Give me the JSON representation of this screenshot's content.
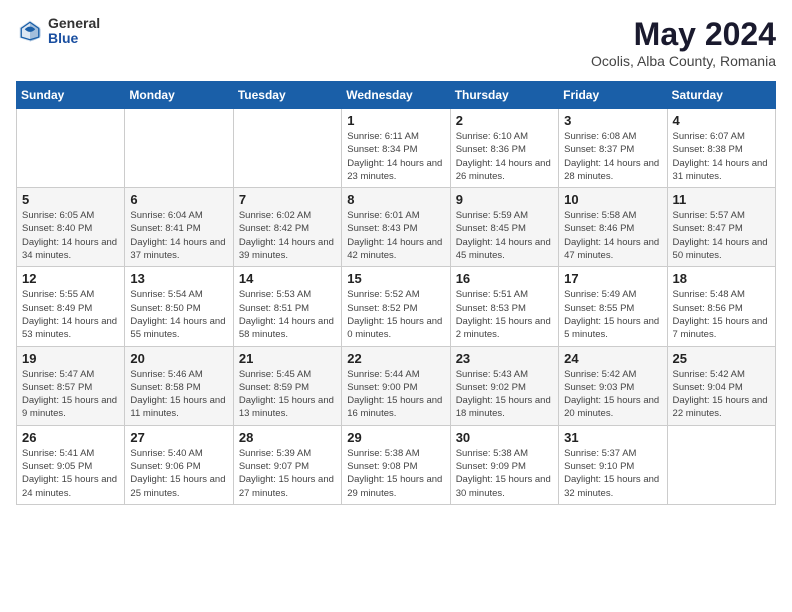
{
  "logo": {
    "general": "General",
    "blue": "Blue"
  },
  "title": {
    "month": "May 2024",
    "location": "Ocolis, Alba County, Romania"
  },
  "weekdays": [
    "Sunday",
    "Monday",
    "Tuesday",
    "Wednesday",
    "Thursday",
    "Friday",
    "Saturday"
  ],
  "weeks": [
    [
      {
        "day": "",
        "sunrise": "",
        "sunset": "",
        "daylight": ""
      },
      {
        "day": "",
        "sunrise": "",
        "sunset": "",
        "daylight": ""
      },
      {
        "day": "",
        "sunrise": "",
        "sunset": "",
        "daylight": ""
      },
      {
        "day": "1",
        "sunrise": "Sunrise: 6:11 AM",
        "sunset": "Sunset: 8:34 PM",
        "daylight": "Daylight: 14 hours and 23 minutes."
      },
      {
        "day": "2",
        "sunrise": "Sunrise: 6:10 AM",
        "sunset": "Sunset: 8:36 PM",
        "daylight": "Daylight: 14 hours and 26 minutes."
      },
      {
        "day": "3",
        "sunrise": "Sunrise: 6:08 AM",
        "sunset": "Sunset: 8:37 PM",
        "daylight": "Daylight: 14 hours and 28 minutes."
      },
      {
        "day": "4",
        "sunrise": "Sunrise: 6:07 AM",
        "sunset": "Sunset: 8:38 PM",
        "daylight": "Daylight: 14 hours and 31 minutes."
      }
    ],
    [
      {
        "day": "5",
        "sunrise": "Sunrise: 6:05 AM",
        "sunset": "Sunset: 8:40 PM",
        "daylight": "Daylight: 14 hours and 34 minutes."
      },
      {
        "day": "6",
        "sunrise": "Sunrise: 6:04 AM",
        "sunset": "Sunset: 8:41 PM",
        "daylight": "Daylight: 14 hours and 37 minutes."
      },
      {
        "day": "7",
        "sunrise": "Sunrise: 6:02 AM",
        "sunset": "Sunset: 8:42 PM",
        "daylight": "Daylight: 14 hours and 39 minutes."
      },
      {
        "day": "8",
        "sunrise": "Sunrise: 6:01 AM",
        "sunset": "Sunset: 8:43 PM",
        "daylight": "Daylight: 14 hours and 42 minutes."
      },
      {
        "day": "9",
        "sunrise": "Sunrise: 5:59 AM",
        "sunset": "Sunset: 8:45 PM",
        "daylight": "Daylight: 14 hours and 45 minutes."
      },
      {
        "day": "10",
        "sunrise": "Sunrise: 5:58 AM",
        "sunset": "Sunset: 8:46 PM",
        "daylight": "Daylight: 14 hours and 47 minutes."
      },
      {
        "day": "11",
        "sunrise": "Sunrise: 5:57 AM",
        "sunset": "Sunset: 8:47 PM",
        "daylight": "Daylight: 14 hours and 50 minutes."
      }
    ],
    [
      {
        "day": "12",
        "sunrise": "Sunrise: 5:55 AM",
        "sunset": "Sunset: 8:49 PM",
        "daylight": "Daylight: 14 hours and 53 minutes."
      },
      {
        "day": "13",
        "sunrise": "Sunrise: 5:54 AM",
        "sunset": "Sunset: 8:50 PM",
        "daylight": "Daylight: 14 hours and 55 minutes."
      },
      {
        "day": "14",
        "sunrise": "Sunrise: 5:53 AM",
        "sunset": "Sunset: 8:51 PM",
        "daylight": "Daylight: 14 hours and 58 minutes."
      },
      {
        "day": "15",
        "sunrise": "Sunrise: 5:52 AM",
        "sunset": "Sunset: 8:52 PM",
        "daylight": "Daylight: 15 hours and 0 minutes."
      },
      {
        "day": "16",
        "sunrise": "Sunrise: 5:51 AM",
        "sunset": "Sunset: 8:53 PM",
        "daylight": "Daylight: 15 hours and 2 minutes."
      },
      {
        "day": "17",
        "sunrise": "Sunrise: 5:49 AM",
        "sunset": "Sunset: 8:55 PM",
        "daylight": "Daylight: 15 hours and 5 minutes."
      },
      {
        "day": "18",
        "sunrise": "Sunrise: 5:48 AM",
        "sunset": "Sunset: 8:56 PM",
        "daylight": "Daylight: 15 hours and 7 minutes."
      }
    ],
    [
      {
        "day": "19",
        "sunrise": "Sunrise: 5:47 AM",
        "sunset": "Sunset: 8:57 PM",
        "daylight": "Daylight: 15 hours and 9 minutes."
      },
      {
        "day": "20",
        "sunrise": "Sunrise: 5:46 AM",
        "sunset": "Sunset: 8:58 PM",
        "daylight": "Daylight: 15 hours and 11 minutes."
      },
      {
        "day": "21",
        "sunrise": "Sunrise: 5:45 AM",
        "sunset": "Sunset: 8:59 PM",
        "daylight": "Daylight: 15 hours and 13 minutes."
      },
      {
        "day": "22",
        "sunrise": "Sunrise: 5:44 AM",
        "sunset": "Sunset: 9:00 PM",
        "daylight": "Daylight: 15 hours and 16 minutes."
      },
      {
        "day": "23",
        "sunrise": "Sunrise: 5:43 AM",
        "sunset": "Sunset: 9:02 PM",
        "daylight": "Daylight: 15 hours and 18 minutes."
      },
      {
        "day": "24",
        "sunrise": "Sunrise: 5:42 AM",
        "sunset": "Sunset: 9:03 PM",
        "daylight": "Daylight: 15 hours and 20 minutes."
      },
      {
        "day": "25",
        "sunrise": "Sunrise: 5:42 AM",
        "sunset": "Sunset: 9:04 PM",
        "daylight": "Daylight: 15 hours and 22 minutes."
      }
    ],
    [
      {
        "day": "26",
        "sunrise": "Sunrise: 5:41 AM",
        "sunset": "Sunset: 9:05 PM",
        "daylight": "Daylight: 15 hours and 24 minutes."
      },
      {
        "day": "27",
        "sunrise": "Sunrise: 5:40 AM",
        "sunset": "Sunset: 9:06 PM",
        "daylight": "Daylight: 15 hours and 25 minutes."
      },
      {
        "day": "28",
        "sunrise": "Sunrise: 5:39 AM",
        "sunset": "Sunset: 9:07 PM",
        "daylight": "Daylight: 15 hours and 27 minutes."
      },
      {
        "day": "29",
        "sunrise": "Sunrise: 5:38 AM",
        "sunset": "Sunset: 9:08 PM",
        "daylight": "Daylight: 15 hours and 29 minutes."
      },
      {
        "day": "30",
        "sunrise": "Sunrise: 5:38 AM",
        "sunset": "Sunset: 9:09 PM",
        "daylight": "Daylight: 15 hours and 30 minutes."
      },
      {
        "day": "31",
        "sunrise": "Sunrise: 5:37 AM",
        "sunset": "Sunset: 9:10 PM",
        "daylight": "Daylight: 15 hours and 32 minutes."
      },
      {
        "day": "",
        "sunrise": "",
        "sunset": "",
        "daylight": ""
      }
    ]
  ]
}
